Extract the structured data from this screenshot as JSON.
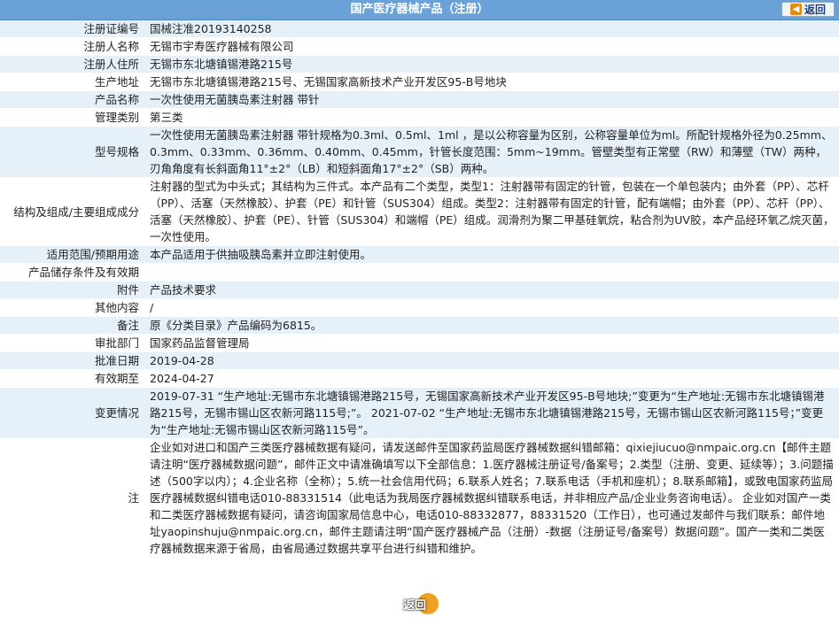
{
  "header": {
    "title": "国产医疗器械产品（注册）",
    "back_label": "返回"
  },
  "fields": [
    {
      "label": "注册证编号",
      "value": "国械注准20193140258"
    },
    {
      "label": "注册人名称",
      "value": "无锡市宇寿医疗器械有限公司"
    },
    {
      "label": "注册人住所",
      "value": "无锡市东北塘镇锡港路215号"
    },
    {
      "label": "生产地址",
      "value": "无锡市东北塘镇锡港路215号、无锡国家高新技术产业开发区95-B号地块"
    },
    {
      "label": "产品名称",
      "value": "一次性使用无菌胰岛素注射器 带针"
    },
    {
      "label": "管理类别",
      "value": "第三类"
    },
    {
      "label": "型号规格",
      "value": "一次性使用无菌胰岛素注射器 带针规格为0.3ml、0.5ml、1ml ，是以公称容量为区别，公称容量单位为ml。所配针规格外径为0.25mm、0.3mm、0.33mm、0.36mm、0.40mm、0.45mm，针管长度范围：5mm~19mm。管壁类型有正常壁（RW）和薄壁（TW）两种，刃角角度有长斜面角11°±2°（LB）和短斜面角17°±2°（SB）两种。"
    },
    {
      "label": "结构及组成/主要组成成分",
      "value": "注射器的型式为中头式；其结构为三件式。本产品有二个类型，类型1：注射器带有固定的针管，包装在一个单包装内；由外套（PP）、芯杆（PP）、活塞（天然橡胶）、护套（PE）和针管（SUS304）组成。类型2：注射器带有固定的针管，配有端帽；由外套（PP）、芯杆（PP）、活塞（天然橡胶）、护套（PE）、针管（SUS304）和端帽（PE）组成。润滑剂为聚二甲基硅氧烷，粘合剂为UV胶，本产品经环氧乙烷灭菌，一次性使用。"
    },
    {
      "label": "适用范围/预期用途",
      "value": "本产品适用于供抽吸胰岛素并立即注射使用。"
    },
    {
      "label": "产品储存条件及有效期",
      "value": ""
    },
    {
      "label": "附件",
      "value": "产品技术要求"
    },
    {
      "label": "其他内容",
      "value": "/"
    },
    {
      "label": "备注",
      "value": "原《分类目录》产品编码为6815。"
    },
    {
      "label": "审批部门",
      "value": "国家药品监督管理局"
    },
    {
      "label": "批准日期",
      "value": "2019-04-28"
    },
    {
      "label": "有效期至",
      "value": "2024-04-27"
    },
    {
      "label": "变更情况",
      "value": "2019-07-31 “生产地址:无锡市东北塘镇锡港路215号，无锡国家高新技术产业开发区95-B号地块;”变更为“生产地址:无锡市东北塘镇锡港路215号，无锡市锡山区农新河路115号;”。 2021-07-02 “生产地址:无锡市东北塘镇锡港路215号，无锡市锡山区农新河路115号；”变更为“生产地址:无锡市锡山区农新河路115号”。"
    },
    {
      "label": "注",
      "value": "企业如对进口和国产三类医疗器械数据有疑问，请发送邮件至国家药监局医疗器械数据纠错邮箱：qixiejiucuo@nmpaic.org.cn【邮件主题请注明“医疗器械数据问题”，邮件正文中请准确填写以下全部信息：1.医疗器械注册证号/备案号；2.类型（注册、变更、延续等）；3.问题描述（500字以内）；4.企业名称（全称）；5.统一社会信用代码；6.联系人姓名；7.联系电话（手机和座机）；8.联系邮箱】，或致电国家药监局医疗器械数据纠错电话010-88331514（此电话为我局医疗器械数据纠错联系电话，并非相应产品/企业业务咨询电话）。 企业如对国产一类和二类医疗器械数据有疑问，请咨询国家局信息中心，电话010-88332877，88331520（工作日），也可通过发邮件与我们联系：邮件地址yaopinshuju@nmpaic.org.cn，邮件主题请注明“国产医疗器械产品（注册）-数据（注册证号/备案号）数据问题”。国产一类和二类医疗器械数据来源于省局，由省局通过数据共享平台进行纠错和维护。"
    }
  ],
  "footer": {
    "back_label": "返回"
  }
}
